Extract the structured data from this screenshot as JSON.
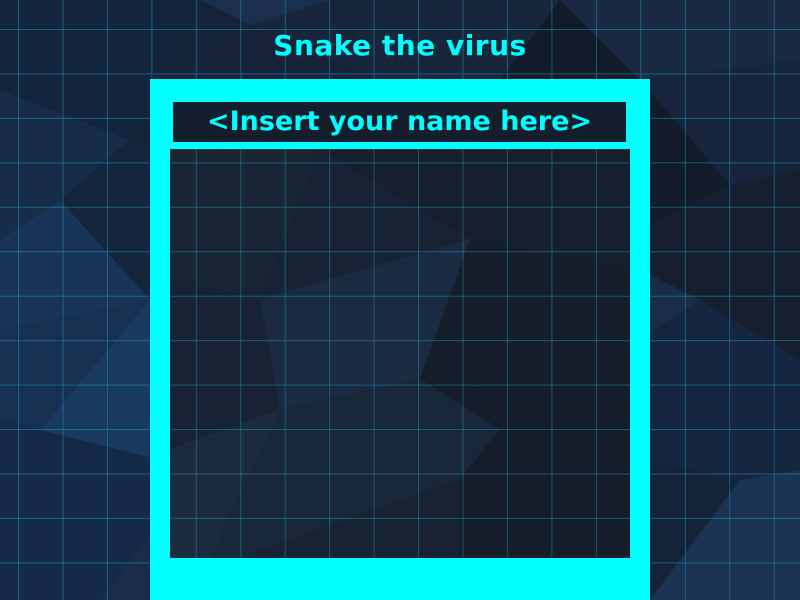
{
  "game": {
    "title": "Snake the virus",
    "name_placeholder": "<Insert your name here>"
  },
  "colors": {
    "accent": "#00ffff",
    "background": "#152238",
    "grid_line": "#1e8fb0",
    "board": "#172334",
    "name_box": "#151e2c"
  }
}
